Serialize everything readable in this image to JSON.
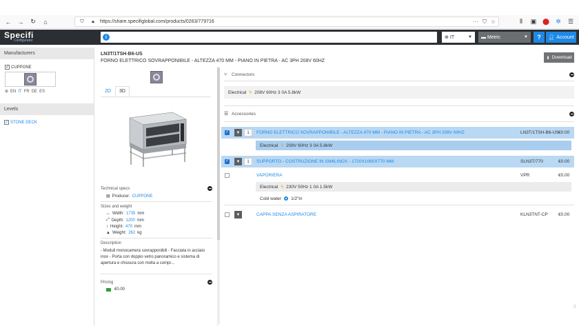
{
  "browser": {
    "url": "https://share.specifiglobal.com/products/0263/779716",
    "more": "···"
  },
  "header": {
    "logo": "Specifi",
    "logo_sub": "Configurator",
    "search_placeholder": "",
    "language": "IT",
    "units": "Metric",
    "help": "?",
    "account": "Account"
  },
  "sidebar": {
    "manufacturers_title": "Manufacturers",
    "manufacturer": "CUPPONE",
    "languages": [
      "EN",
      "IT",
      "FR",
      "DE",
      "ES"
    ],
    "levels_title": "Levels",
    "level": "STONE DECK"
  },
  "product": {
    "code": "LN3T/1TSH-B6-US",
    "name": "FORNO ELETTRICO SOVRAPPONIBILE - ALTEZZA 470 MM - PIANO IN PIETRA - AC 3PH 208V 60HZ",
    "download": "Download",
    "tabs": [
      "2D",
      "3D"
    ],
    "tech_title": "Technical specs",
    "producer_label": "Producer:",
    "producer": "CUPPONE",
    "sizes_title": "Sizes and weight",
    "width_label": "Width:",
    "width": "1735",
    "depth_label": "Depth:",
    "depth": "1200",
    "height_label": "Height:",
    "height": "470",
    "mm": "mm",
    "weight_label": "Weight:",
    "weight": "262",
    "kg": "kg",
    "desc_title": "Description",
    "description": "- Moduli monocamera sovrapponibili - Facciata in acciaio inox - Porta con doppio vetro panoramico e sistema di apertura e chiusura con molla a compr...",
    "pricing_title": "Pricing",
    "price": "€0.00"
  },
  "connectors": {
    "title": "Connectors",
    "electrical_label": "Electrical",
    "electrical_value": "208V 60Hz 3 0A 5.8kW"
  },
  "accessories": {
    "title": "Accessories",
    "items": [
      {
        "name": "FORNO ELETTRICO SOVRAPPONIBILE - ALTEZZA 470 MM - PIANO IN PIETRA - AC 3PH 208V 60HZ",
        "code": "LN3T/1TSH-B6-US",
        "price": "€0.00",
        "qty": "1"
      },
      {
        "name": "SUPPORTO - COSTRUZIONE IN SIMILINOX - 1720X1060X770 MM",
        "code": "SLN3T/770",
        "price": "€0.00",
        "qty": "1"
      },
      {
        "name": "VAPORIERA",
        "code": "VPR",
        "price": "€0.00"
      },
      {
        "name": "CAPPA SENZA ASPIRATORE",
        "code": "KLN3TNT-CP",
        "price": "€0.00"
      }
    ],
    "sub1_label": "Electrical",
    "sub1_value": "208V 60Hz 3 0A 5.8kW",
    "sub2_label": "Electrical",
    "sub2_value": "230V 50Hz 1 0A 1.5kW",
    "sub3_label": "Cold water",
    "sub3_value": "1/2\"in"
  }
}
